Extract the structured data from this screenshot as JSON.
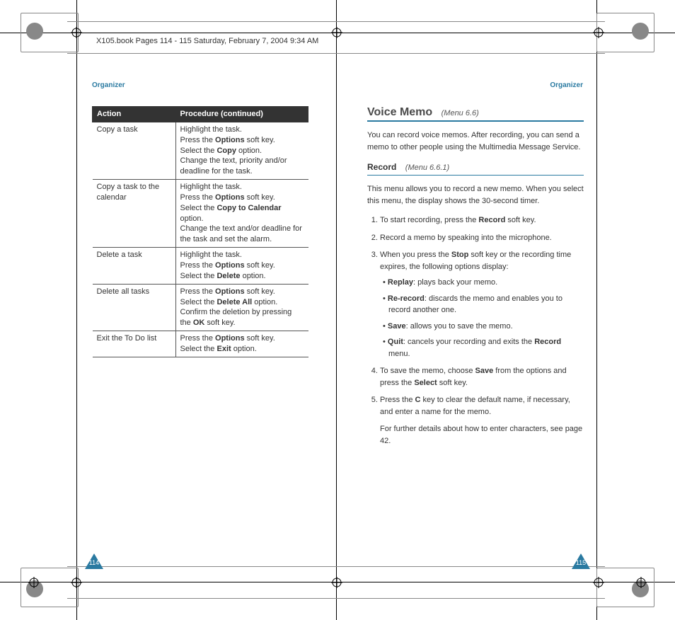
{
  "file_header": "X105.book  Pages 114 - 115  Saturday, February 7, 2004  9:34 AM",
  "header_left": "Organizer",
  "header_right": "Organizer",
  "page_left_num": "114",
  "page_right_num": "115",
  "table": {
    "h1": "Action",
    "h2": "Procedure",
    "h2_cont": "  (continued)",
    "rows": [
      {
        "action": "Copy a task",
        "proc": "Highlight the task.\nPress the <b>Options</b> soft key.\nSelect the <b>Copy</b> option.\nChange the text, priority and/or deadline for the task."
      },
      {
        "action": "Copy a task to the calendar",
        "proc": "Highlight the task.\nPress the <b>Options</b> soft key.\nSelect the <b>Copy to Calendar</b> option.\nChange the text and/or deadline for the task and set the alarm."
      },
      {
        "action": "Delete a task",
        "proc": "Highlight the task.\nPress the <b>Options</b> soft key.\nSelect the <b>Delete</b> option."
      },
      {
        "action": "Delete all tasks",
        "proc": "Press the <b>Options</b> soft key.\nSelect the <b>Delete All</b> option.\nConfirm the deletion by pressing the <b>OK</b> soft key."
      },
      {
        "action": "Exit the To Do list",
        "proc": "Press the <b>Options</b> soft key.\nSelect the <b>Exit</b> option."
      }
    ]
  },
  "right": {
    "h2": "Voice Memo",
    "h2_ref": "(Menu 6.6)",
    "intro": "You can record voice memos. After recording, you can send a memo to other people using the Multimedia Message Service.",
    "h3": "Record",
    "h3_ref": "(Menu 6.6.1)",
    "sub_intro": "This menu allows you to record a new memo. When you select this menu, the display shows the 30-second timer.",
    "steps": [
      "To start recording, press the <b>Record</b> soft key.",
      "Record a memo by speaking into the microphone.",
      "When you press the <b>Stop</b> soft key or the recording time expires, the following options display:",
      "To save the memo, choose <b>Save</b> from the options and press the <b>Select</b> soft key.",
      "Press the <b>C</b> key to clear the default name, if necessary, and enter a name for the memo."
    ],
    "opts": [
      "<b>Replay</b>: plays back your memo.",
      "<b>Re-record</b>: discards the memo and enables you to record another one.",
      "<b>Save</b>: allows you to save the memo.",
      "<b>Quit</b>: cancels your recording and exits the <b>Record</b> menu."
    ],
    "footnote": "For further details about how to enter characters, see page 42."
  }
}
